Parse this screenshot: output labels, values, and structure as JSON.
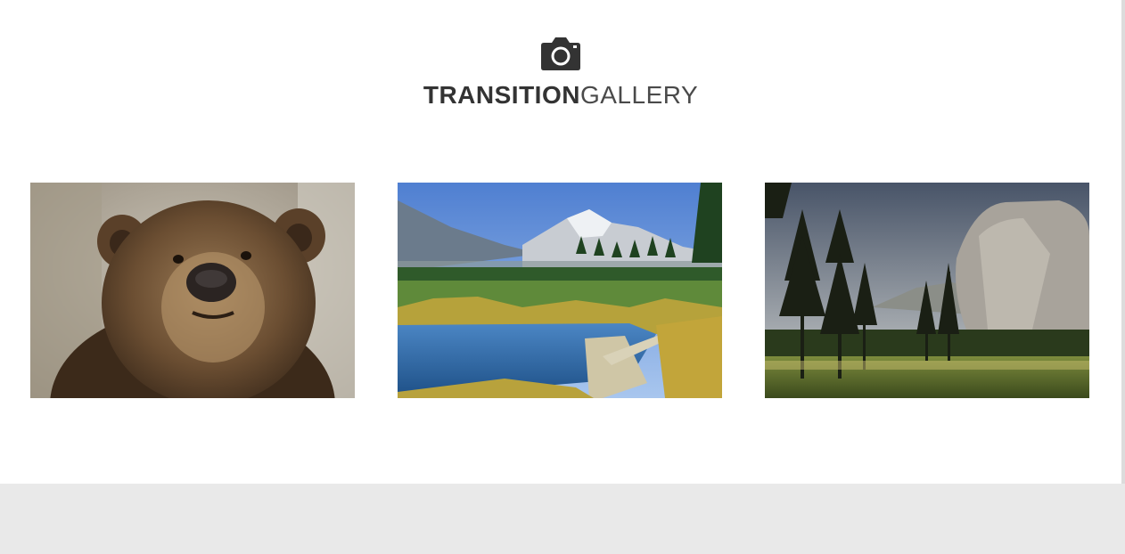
{
  "header": {
    "icon": "camera-icon",
    "title_bold": "TRANSITION",
    "title_light": "GALLERY"
  },
  "gallery": {
    "items": [
      {
        "name": "bear-photo",
        "subject": "brown bear"
      },
      {
        "name": "alpine-lake-photo",
        "subject": "mountain lake with boardwalk"
      },
      {
        "name": "valley-cliff-photo",
        "subject": "pine trees and granite cliff"
      }
    ]
  },
  "colors": {
    "text_dark": "#333333",
    "footer_bg": "#e9e9e9",
    "page_bg": "#ffffff"
  }
}
